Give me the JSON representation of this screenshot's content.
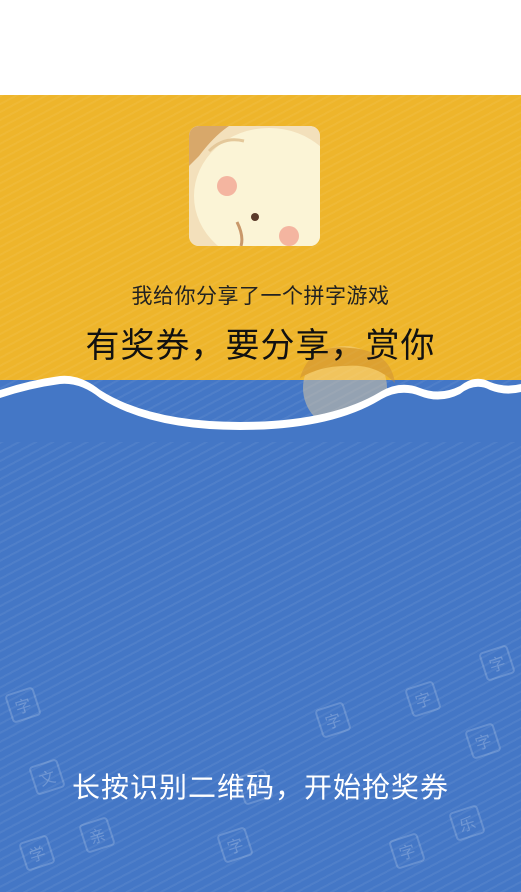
{
  "share_card": {
    "share_text": "我给你分享了一个拼字游戏",
    "headline": "有奖券，要分享，赏你",
    "cta": "长按识别二维码，开始抢奖券"
  },
  "decor_tiles": [
    "字",
    "字",
    "字",
    "字",
    "字",
    "字",
    "乐",
    "文",
    "亲",
    "学",
    "字",
    "字"
  ],
  "colors": {
    "yellow": "#EEB52B",
    "blue": "#4477C6",
    "text_dark": "#222222",
    "text_light": "#FFFFFF"
  },
  "icons": {
    "avatar": "cartoon-character-avatar"
  }
}
